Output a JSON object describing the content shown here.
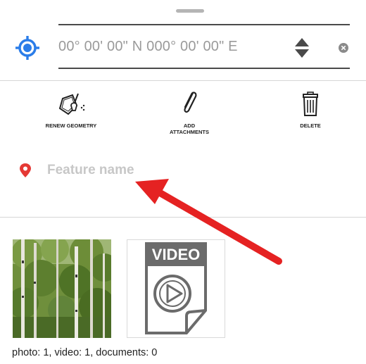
{
  "coordinate": {
    "placeholder": "00° 00' 00\" N 000° 00' 00\" E"
  },
  "toolbar": {
    "renew_geometry_label": "RENEW GEOMETRY",
    "add_attachments_line1": "ADD",
    "add_attachments_line2": "ATTACHMENTS",
    "delete_label": "DELETE"
  },
  "feature": {
    "name_placeholder": "Feature name"
  },
  "attachments": {
    "video_badge": "VIDEO",
    "counts": "photo: 1, video: 1, documents: 0"
  },
  "colors": {
    "accent_blue": "#2b7de9",
    "pin_red": "#e53935",
    "annotation_red": "#e52222"
  },
  "icons": {
    "locate": "crosshair-location-icon",
    "sort": "sort-arrows-icon",
    "clear": "clear-icon",
    "renew": "renew-geometry-icon",
    "attach": "paperclip-icon",
    "delete": "trash-icon",
    "pin": "map-pin-icon",
    "play": "play-icon"
  }
}
